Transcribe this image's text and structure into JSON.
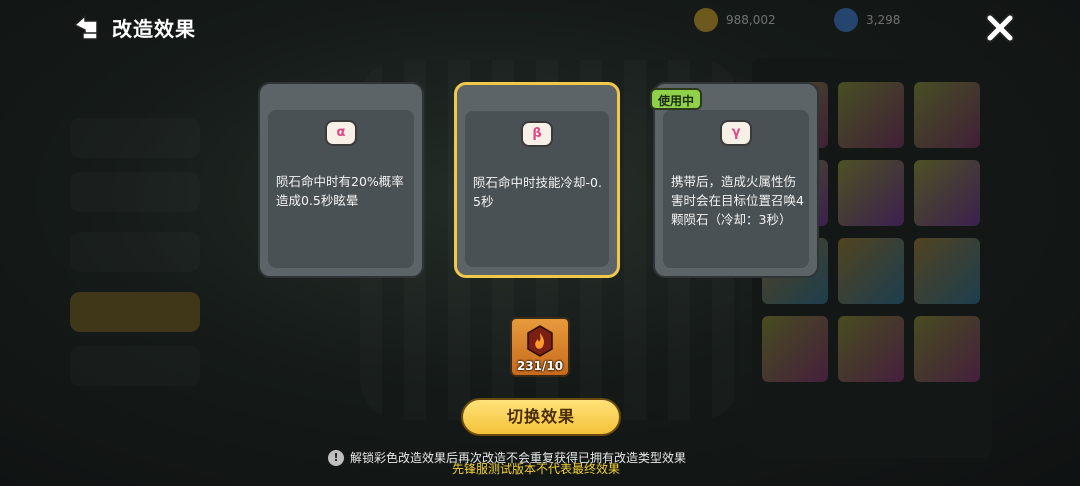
{
  "header": {
    "title": "改造效果"
  },
  "currency": [
    {
      "name": "gold-coin",
      "value": "988,002",
      "color": "#d9a623"
    },
    {
      "name": "blue-gem",
      "value": "3,298",
      "color": "#3b7ad8"
    }
  ],
  "cards": [
    {
      "badge": "α",
      "description": "陨石命中时有20%概率造成0.5秒眩晕",
      "selected": false,
      "in_use": false
    },
    {
      "badge": "β",
      "description": "陨石命中时技能冷却-0.5秒",
      "selected": true,
      "in_use": false
    },
    {
      "badge": "γ",
      "description": "携带后，造成火属性伤害时会在目标位置召唤4颗陨石（冷却：3秒）",
      "selected": false,
      "in_use": true
    }
  ],
  "in_use_label": "使用中",
  "material": {
    "count": "231/10"
  },
  "switch_button": "切换效果",
  "notice": "解锁彩色改造效果后再次改造不会重复获得已拥有改造类型效果",
  "watermark": "先锋服测试版本不代表最终效果",
  "colors": {
    "accent": "#f2c84a",
    "in_use": "#8fd24a"
  }
}
